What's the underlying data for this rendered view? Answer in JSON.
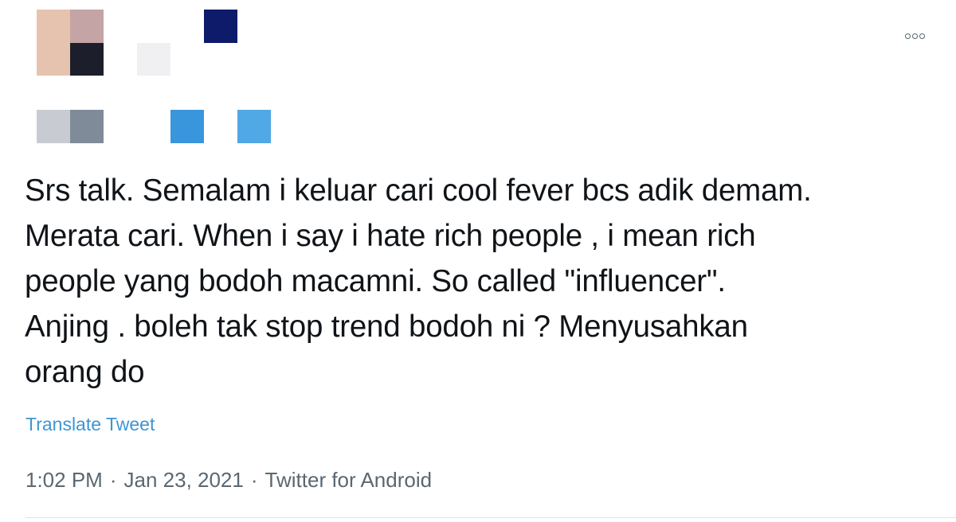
{
  "tweet": {
    "text": "Srs talk. Semalam i keluar cari cool fever bcs adik demam.\nMerata cari. When i say i hate rich people , i mean rich\npeople yang bodoh macamni. So called \"influencer\".\nAnjing . boleh tak stop trend bodoh ni ? Menyusahkan\norang do",
    "translate_label": "Translate Tweet",
    "time": "1:02 PM",
    "separator": "·",
    "date": "Jan 23, 2021",
    "source": "Twitter for Android"
  },
  "more_menu": {
    "icon": "more-horizontal-icon"
  },
  "censor": {
    "colors": [
      "#e6c3ae",
      "#c4a4a4",
      "#1c1f2b",
      "#f0f0f2",
      "#0e1a6a",
      "#c8ccd2",
      "#7f8b98",
      "#3a96dc",
      "#50a8e4"
    ]
  },
  "colors": {
    "text": "#101418",
    "link": "#3d95d3",
    "meta": "#5b6770",
    "divider": "#dde3e8"
  }
}
